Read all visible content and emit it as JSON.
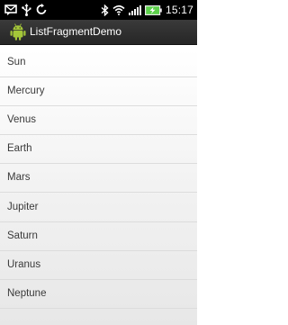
{
  "status_bar": {
    "time": "15:17",
    "icons": [
      "sms-icon",
      "usb-icon",
      "sync-icon",
      "bluetooth-icon",
      "wifi-icon",
      "signal-icon",
      "battery-icon"
    ],
    "colors": {
      "background": "#000000",
      "battery": "#5cd04a"
    }
  },
  "action_bar": {
    "title": "ListFragmentDemo",
    "icon": "android-robot-icon",
    "colors": {
      "background": "#2f2f2f",
      "icon": "#a4c639"
    }
  },
  "list": {
    "items": [
      {
        "label": "Sun"
      },
      {
        "label": "Mercury"
      },
      {
        "label": "Venus"
      },
      {
        "label": "Earth"
      },
      {
        "label": "Mars"
      },
      {
        "label": "Jupiter"
      },
      {
        "label": "Saturn"
      },
      {
        "label": "Uranus"
      },
      {
        "label": "Neptune"
      }
    ]
  }
}
